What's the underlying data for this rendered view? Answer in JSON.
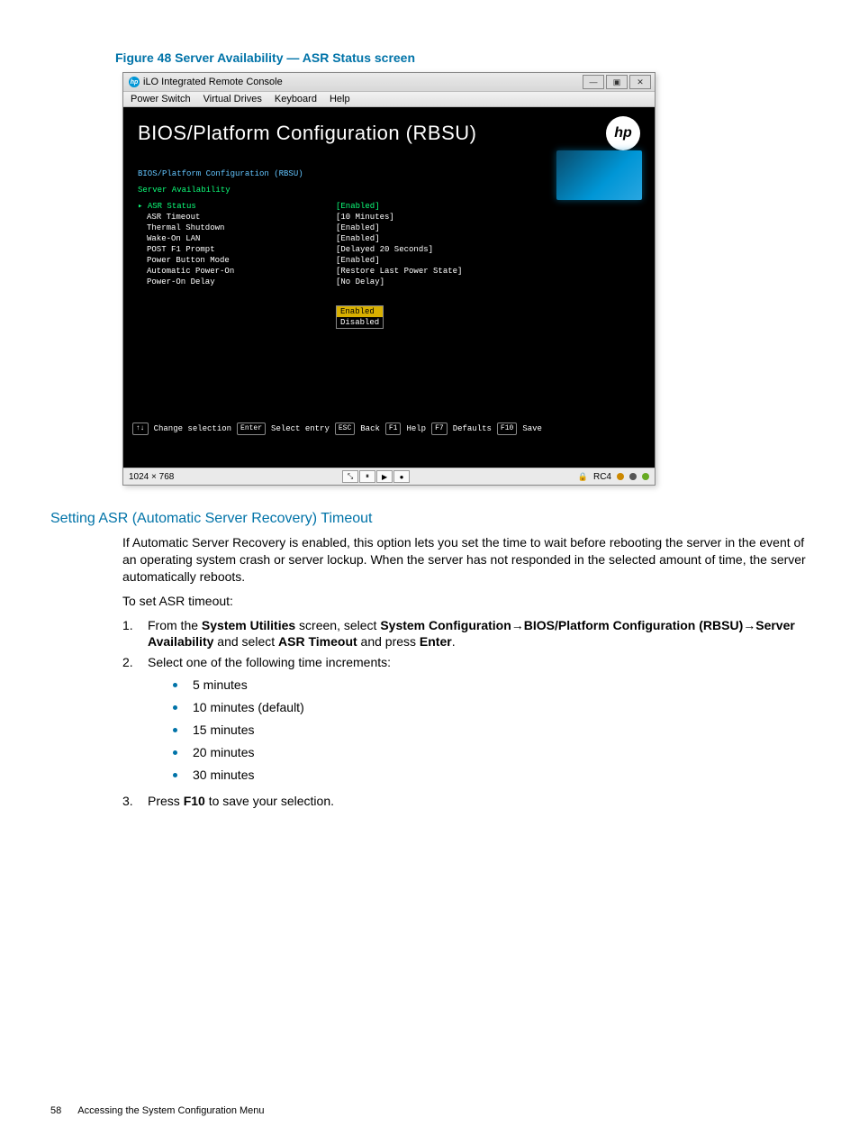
{
  "figure": {
    "caption": "Figure 48 Server Availability — ASR Status screen"
  },
  "console": {
    "window_title": "iLO Integrated Remote Console",
    "hp_favicon_text": "hp",
    "win_controls": {
      "min": "—",
      "max": "▣",
      "close": "✕"
    },
    "menubar": [
      "Power Switch",
      "Virtual Drives",
      "Keyboard",
      "Help"
    ],
    "bios": {
      "header_title": "BIOS/Platform Configuration (RBSU)",
      "hp_logo_text": "hp",
      "breadcrumb1": "BIOS/Platform Configuration (RBSU)",
      "breadcrumb2": "Server Availability",
      "rows": [
        {
          "label": "ASR Status",
          "value": "[Enabled]",
          "selected": true
        },
        {
          "label": "ASR Timeout",
          "value": "[10 Minutes]"
        },
        {
          "label": "Thermal Shutdown",
          "value": "[Enabled]"
        },
        {
          "label": "Wake-On LAN",
          "value": "[Enabled]"
        },
        {
          "label": "POST F1 Prompt",
          "value": "[Delayed 20 Seconds]"
        },
        {
          "label": "Power Button Mode",
          "value": "[Enabled]"
        },
        {
          "label": "Automatic Power-On",
          "value": "[Restore Last Power State]"
        },
        {
          "label": "Power-On Delay",
          "value": "[No Delay]"
        }
      ],
      "dropdown": {
        "selected": "Enabled",
        "other": "Disabled"
      },
      "footer_keys": [
        {
          "key": "↑↓",
          "label": "Change selection"
        },
        {
          "key": "Enter",
          "label": "Select entry"
        },
        {
          "key": "ESC",
          "label": "Back"
        },
        {
          "key": "F1",
          "label": "Help"
        },
        {
          "key": "F7",
          "label": "Defaults"
        },
        {
          "key": "F10",
          "label": "Save"
        }
      ]
    },
    "statusbar": {
      "resolution": "1024 × 768",
      "encryption": "RC4",
      "controls": [
        "⤡",
        "⏸",
        "▶",
        "●"
      ]
    }
  },
  "section": {
    "heading": "Setting ASR (Automatic Server Recovery) Timeout",
    "intro": "If Automatic Server Recovery is enabled, this option lets you set the time to wait before rebooting the server in the event of an operating system crash or server lockup. When the server has not responded in the selected amount of time, the server automatically reboots.",
    "proc_lead": "To set ASR timeout:",
    "steps": {
      "s1": {
        "num": "1.",
        "p1": "From the ",
        "b1": "System Utilities",
        "p2": " screen, select ",
        "b2": "System Configuration",
        "arr": "→",
        "b3": "BIOS/Platform Configuration (RBSU)",
        "b4": "Server Availability",
        "p3": " and select ",
        "b5": "ASR Timeout",
        "p4": " and press ",
        "b6": "Enter",
        "p5": "."
      },
      "s2": {
        "num": "2.",
        "text": "Select one of the following time increments:",
        "items": [
          "5 minutes",
          "10 minutes (default)",
          "15 minutes",
          "20 minutes",
          "30 minutes"
        ]
      },
      "s3": {
        "num": "3.",
        "p1": "Press ",
        "b1": "F10",
        "p2": " to save your selection."
      }
    }
  },
  "footer": {
    "page_number": "58",
    "chapter": "Accessing the System Configuration Menu"
  }
}
